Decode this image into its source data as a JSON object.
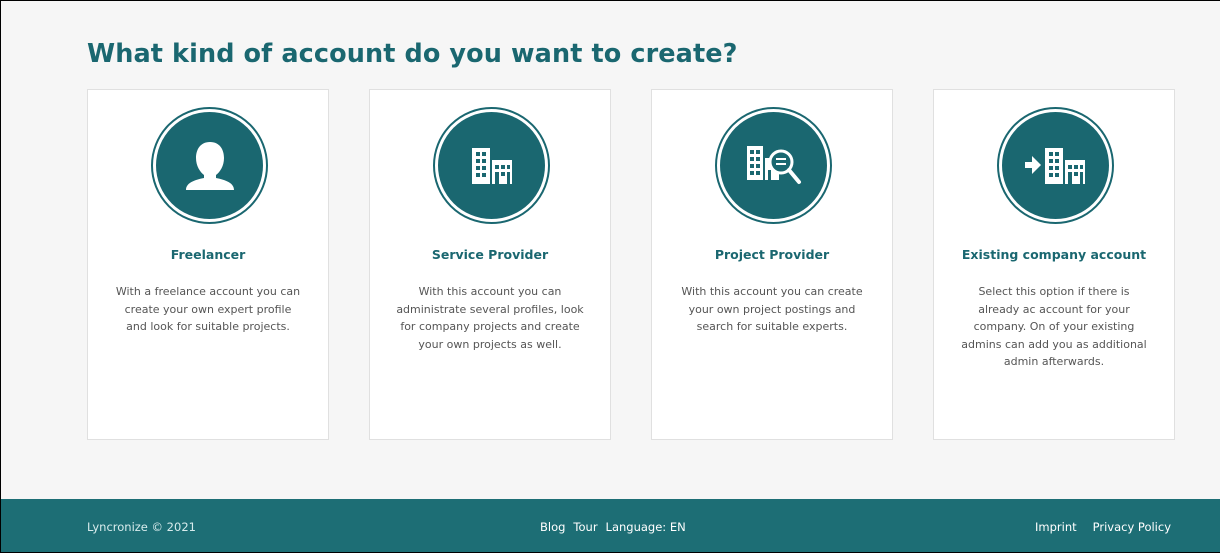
{
  "page": {
    "title": "What kind of account do you want to create?"
  },
  "cards": [
    {
      "icon": "user-silhouette-icon",
      "title": "Freelancer",
      "description": "With a freelance account you can create your own expert profile and look for suitable projects."
    },
    {
      "icon": "buildings-icon",
      "title": "Service Provider",
      "description": "With this account you can administrate several profiles, look for company projects and create your own projects as well."
    },
    {
      "icon": "building-search-icon",
      "title": "Project Provider",
      "description": "With this account you can create your own project postings and search for suitable experts."
    },
    {
      "icon": "arrow-into-building-icon",
      "title": "Existing company account",
      "description": "Select this option if there is already ac account for your company. On of your existing admins can add you as additional admin afterwards."
    }
  ],
  "footer": {
    "copyright": "Lyncronize © 2021",
    "blog_label": "Blog",
    "tour_label": "Tour",
    "language_label": "Language: EN",
    "imprint_label": "Imprint",
    "privacy_label": "Privacy Policy"
  },
  "colors": {
    "accent": "#1a6770",
    "footer_bg": "#1d6e75",
    "page_bg": "#f6f6f6",
    "card_bg": "#ffffff",
    "body_text": "#555555"
  }
}
